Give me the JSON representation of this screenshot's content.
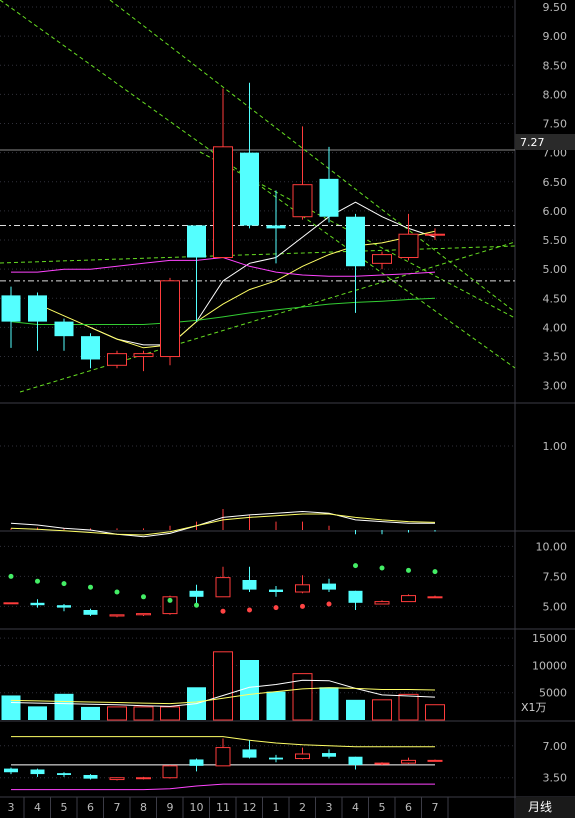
{
  "price_marker": "7.27",
  "unit_label": "X1万",
  "period_label": "月线",
  "colors": {
    "bg": "#000000",
    "up": "#ff3c3c",
    "down": "#54ffff",
    "ma1": "#ffffff",
    "ma2": "#ffff66",
    "ma3": "#ff44ff",
    "ma4": "#33cc33",
    "trend": "#66dd22",
    "axis_text": "#bbbbbb",
    "grid": "#30303a"
  },
  "chart_data": [
    {
      "type": "candlestick",
      "panel": "price",
      "categories": [
        "3",
        "4",
        "5",
        "6",
        "7",
        "8",
        "9",
        "10",
        "11",
        "12",
        "1",
        "2",
        "3",
        "4",
        "5",
        "6",
        "7"
      ],
      "candles": [
        {
          "o": 4.55,
          "h": 4.7,
          "l": 3.65,
          "c": 4.1
        },
        {
          "o": 4.55,
          "h": 4.6,
          "l": 3.6,
          "c": 4.1
        },
        {
          "o": 4.1,
          "h": 4.15,
          "l": 3.6,
          "c": 3.85
        },
        {
          "o": 3.85,
          "h": 3.9,
          "l": 3.3,
          "c": 3.45
        },
        {
          "o": 3.35,
          "h": 3.6,
          "l": 3.3,
          "c": 3.55
        },
        {
          "o": 3.5,
          "h": 3.6,
          "l": 3.25,
          "c": 3.55
        },
        {
          "o": 3.5,
          "h": 4.85,
          "l": 3.35,
          "c": 4.8
        },
        {
          "o": 5.75,
          "h": 5.75,
          "l": 4.1,
          "c": 5.2
        },
        {
          "o": 5.2,
          "h": 8.1,
          "l": 5.2,
          "c": 7.1
        },
        {
          "o": 7.0,
          "h": 8.2,
          "l": 5.7,
          "c": 5.75
        },
        {
          "o": 5.75,
          "h": 6.35,
          "l": 5.1,
          "c": 5.7
        },
        {
          "o": 5.9,
          "h": 7.45,
          "l": 5.85,
          "c": 6.45
        },
        {
          "o": 6.55,
          "h": 7.1,
          "l": 5.8,
          "c": 5.9
        },
        {
          "o": 5.9,
          "h": 5.95,
          "l": 4.25,
          "c": 5.05
        },
        {
          "o": 5.1,
          "h": 5.3,
          "l": 5.0,
          "c": 5.25
        },
        {
          "o": 5.2,
          "h": 5.95,
          "l": 5.15,
          "c": 5.6
        },
        {
          "o": 5.6,
          "h": 5.7,
          "l": 5.5,
          "c": 5.6
        }
      ],
      "ylim": [
        2.72,
        9.62
      ],
      "yticks": [
        "9.50",
        "9.00",
        "8.50",
        "8.00",
        "7.50",
        "7.00",
        "6.50",
        "6.00",
        "5.50",
        "5.00",
        "4.50",
        "4.00",
        "3.50",
        "3.00"
      ],
      "ma_series": [
        {
          "values": [
            null,
            null,
            null,
            4.0,
            3.8,
            3.7,
            3.7,
            4.1,
            4.8,
            5.1,
            5.2,
            5.55,
            5.9,
            6.15,
            5.9,
            5.7,
            5.55
          ]
        },
        {
          "values": [
            null,
            4.4,
            4.2,
            4.0,
            3.8,
            3.65,
            3.7,
            4.1,
            4.4,
            4.65,
            4.8,
            5.05,
            5.25,
            5.4,
            5.45,
            5.55,
            5.65
          ]
        },
        {
          "values": [
            4.95,
            4.95,
            5.0,
            5.0,
            5.05,
            5.1,
            5.15,
            5.15,
            5.2,
            5.05,
            4.95,
            4.9,
            4.88,
            4.88,
            4.9,
            4.92,
            4.95
          ]
        },
        {
          "values": [
            4.1,
            4.05,
            4.05,
            4.05,
            4.05,
            4.05,
            4.08,
            4.12,
            4.18,
            4.25,
            4.3,
            4.35,
            4.4,
            4.43,
            4.45,
            4.48,
            4.5
          ]
        }
      ],
      "horizontal_levels": [
        5.75,
        4.8
      ]
    },
    {
      "type": "line",
      "panel": "indicator_1",
      "ylim": [
        0,
        1.5
      ],
      "yticks": [
        "1.00"
      ],
      "series": [
        {
          "values": [
            0.08,
            0.06,
            0.02,
            0.0,
            -0.05,
            -0.08,
            -0.04,
            0.05,
            0.15,
            0.18,
            0.2,
            0.22,
            0.2,
            0.12,
            0.1,
            0.08,
            0.08
          ]
        },
        {
          "values": [
            0.02,
            0.01,
            -0.01,
            -0.03,
            -0.05,
            -0.06,
            -0.02,
            0.05,
            0.12,
            0.15,
            0.17,
            0.19,
            0.19,
            0.15,
            0.12,
            0.1,
            0.09
          ]
        }
      ],
      "bars": [
        0.02,
        0.03,
        0.02,
        0.02,
        0.02,
        0.02,
        0.05,
        0.1,
        0.25,
        0.18,
        0.1,
        0.1,
        0.05,
        -0.05,
        -0.05,
        -0.03,
        -0.02
      ]
    },
    {
      "type": "candlestick",
      "panel": "indicator_2",
      "ylim": [
        3.2,
        11.2
      ],
      "yticks": [
        "10.00",
        "7.50",
        "5.00"
      ],
      "candles": [
        {
          "o": 5.3,
          "h": 5.3,
          "l": 5.3,
          "c": 5.3
        },
        {
          "o": 5.3,
          "h": 5.6,
          "l": 4.9,
          "c": 5.1
        },
        {
          "o": 5.1,
          "h": 5.2,
          "l": 4.6,
          "c": 4.9
        },
        {
          "o": 4.7,
          "h": 4.8,
          "l": 4.2,
          "c": 4.3
        },
        {
          "o": 4.2,
          "h": 4.3,
          "l": 4.1,
          "c": 4.3
        },
        {
          "o": 4.3,
          "h": 4.4,
          "l": 4.2,
          "c": 4.4
        },
        {
          "o": 4.4,
          "h": 5.9,
          "l": 4.3,
          "c": 5.8
        },
        {
          "o": 6.3,
          "h": 6.8,
          "l": 5.1,
          "c": 5.8
        },
        {
          "o": 5.8,
          "h": 8.3,
          "l": 5.8,
          "c": 7.4
        },
        {
          "o": 7.2,
          "h": 8.3,
          "l": 6.2,
          "c": 6.4
        },
        {
          "o": 6.4,
          "h": 6.7,
          "l": 5.8,
          "c": 6.2
        },
        {
          "o": 6.2,
          "h": 7.6,
          "l": 6.1,
          "c": 6.8
        },
        {
          "o": 6.9,
          "h": 7.3,
          "l": 6.2,
          "c": 6.4
        },
        {
          "o": 6.3,
          "h": 6.3,
          "l": 4.7,
          "c": 5.3
        },
        {
          "o": 5.2,
          "h": 5.5,
          "l": 5.2,
          "c": 5.4
        },
        {
          "o": 5.4,
          "h": 6.0,
          "l": 5.4,
          "c": 5.9
        },
        {
          "o": 5.8,
          "h": 5.9,
          "l": 5.7,
          "c": 5.8
        }
      ],
      "dots": [
        {
          "v": 7.5,
          "color": "#44ee66"
        },
        {
          "v": 7.1,
          "color": "#44ee66"
        },
        {
          "v": 6.9,
          "color": "#44ee66"
        },
        {
          "v": 6.6,
          "color": "#44ee66"
        },
        {
          "v": 6.2,
          "color": "#44ee66"
        },
        {
          "v": 5.8,
          "color": "#44ee66"
        },
        {
          "v": 5.5,
          "color": "#44ee66"
        },
        {
          "v": 5.1,
          "color": "#44ee66"
        },
        {
          "v": 4.6,
          "color": "#ff4444"
        },
        {
          "v": 4.7,
          "color": "#ff4444"
        },
        {
          "v": 4.9,
          "color": "#ff4444"
        },
        {
          "v": 5.0,
          "color": "#ff4444"
        },
        {
          "v": 5.2,
          "color": "#ff4444"
        },
        {
          "v": 8.4,
          "color": "#44ee66"
        },
        {
          "v": 8.2,
          "color": "#44ee66"
        },
        {
          "v": 8.0,
          "color": "#44ee66"
        },
        {
          "v": 7.9,
          "color": "#44ee66"
        }
      ]
    },
    {
      "type": "bar",
      "panel": "volume",
      "ylim": [
        0,
        16500
      ],
      "yticks": [
        "15000",
        "10000",
        "5000"
      ],
      "values": [
        4500,
        2500,
        4800,
        2400,
        2400,
        2400,
        2400,
        6000,
        12500,
        11000,
        5200,
        8500,
        6000,
        3700,
        3700,
        4700,
        2800
      ],
      "up": [
        false,
        false,
        false,
        false,
        true,
        true,
        true,
        false,
        true,
        false,
        false,
        true,
        false,
        false,
        true,
        true,
        true
      ],
      "ma_series": [
        {
          "values": [
            3200,
            3100,
            3000,
            2900,
            2800,
            2600,
            2500,
            3000,
            4500,
            6000,
            6500,
            7300,
            7200,
            5800,
            4600,
            4400,
            4200
          ]
        },
        {
          "values": [
            3600,
            3500,
            3400,
            3300,
            3200,
            3100,
            3000,
            3300,
            4000,
            4700,
            5200,
            5700,
            5900,
            5800,
            5600,
            5600,
            5500
          ]
        }
      ]
    },
    {
      "type": "candlestick",
      "panel": "indicator_3",
      "ylim": [
        1.5,
        9.6
      ],
      "yticks": [
        "7.00",
        "3.50"
      ],
      "candles": [
        {
          "o": 4.5,
          "h": 4.6,
          "l": 3.9,
          "c": 4.1
        },
        {
          "o": 4.4,
          "h": 4.5,
          "l": 3.6,
          "c": 3.9
        },
        {
          "o": 4.0,
          "h": 4.1,
          "l": 3.6,
          "c": 3.8
        },
        {
          "o": 3.8,
          "h": 3.9,
          "l": 3.3,
          "c": 3.4
        },
        {
          "o": 3.3,
          "h": 3.5,
          "l": 3.2,
          "c": 3.5
        },
        {
          "o": 3.4,
          "h": 3.6,
          "l": 3.3,
          "c": 3.5
        },
        {
          "o": 3.5,
          "h": 4.9,
          "l": 3.4,
          "c": 4.8
        },
        {
          "o": 5.5,
          "h": 5.6,
          "l": 4.2,
          "c": 4.8
        },
        {
          "o": 4.8,
          "h": 7.8,
          "l": 4.8,
          "c": 6.8
        },
        {
          "o": 6.6,
          "h": 7.6,
          "l": 5.6,
          "c": 5.7
        },
        {
          "o": 5.7,
          "h": 6.0,
          "l": 5.2,
          "c": 5.5
        },
        {
          "o": 5.6,
          "h": 6.8,
          "l": 5.5,
          "c": 6.1
        },
        {
          "o": 6.2,
          "h": 6.6,
          "l": 5.6,
          "c": 5.8
        },
        {
          "o": 5.8,
          "h": 5.8,
          "l": 4.4,
          "c": 4.9
        },
        {
          "o": 5.0,
          "h": 5.2,
          "l": 4.9,
          "c": 5.1
        },
        {
          "o": 5.1,
          "h": 5.7,
          "l": 5.0,
          "c": 5.4
        },
        {
          "o": 5.4,
          "h": 5.5,
          "l": 5.3,
          "c": 5.4
        }
      ],
      "lines": [
        {
          "values": [
            8.0,
            8.0,
            8.0,
            8.0,
            8.0,
            8.0,
            8.0,
            8.0,
            8.0,
            7.6,
            7.3,
            7.1,
            7.0,
            6.9,
            6.9,
            6.9,
            6.9
          ],
          "color": "#ffff66"
        },
        {
          "values": [
            4.9,
            4.9,
            4.9,
            4.9,
            4.9,
            4.9,
            4.9,
            4.9,
            4.9,
            4.9,
            4.9,
            4.9,
            4.9,
            4.9,
            4.9,
            4.9,
            4.9
          ],
          "color": "#ffffff"
        },
        {
          "values": [
            2.2,
            2.2,
            2.2,
            2.2,
            2.2,
            2.2,
            2.3,
            2.6,
            2.8,
            2.8,
            2.8,
            2.8,
            2.8,
            2.8,
            2.8,
            2.8,
            2.8
          ],
          "color": "#ff44ff"
        }
      ]
    }
  ]
}
